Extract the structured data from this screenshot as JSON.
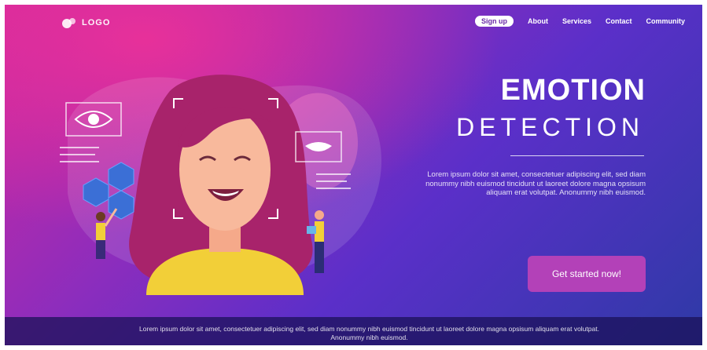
{
  "header": {
    "logo_text": "LOGO",
    "nav": {
      "signup": "Sign up",
      "about": "About",
      "services": "Services",
      "contact": "Contact",
      "community": "Community"
    }
  },
  "hero": {
    "title_line1": "EMOTION",
    "title_line2": "DETECTION",
    "description": "Lorem ipsum dolor sit amet, consectetuer adipiscing elit, sed diam nonummy nibh euismod tincidunt ut laoreet dolore magna opsisum aliquam erat volutpat. Anonummy nibh euismod.",
    "cta_label": "Get started now!"
  },
  "footer": {
    "text": "Lorem ipsum dolor sit amet, consectetuer adipiscing elit, sed diam nonummy nibh euismod tincidunt ut laoreet dolore magna opsisum aliquam erat volutpat. Anonummy nibh euismod."
  },
  "colors": {
    "accent_pink": "#e7309a",
    "accent_purple": "#8c2dbd",
    "deep_blue": "#2e3aa6",
    "cta": "#b341b8"
  }
}
